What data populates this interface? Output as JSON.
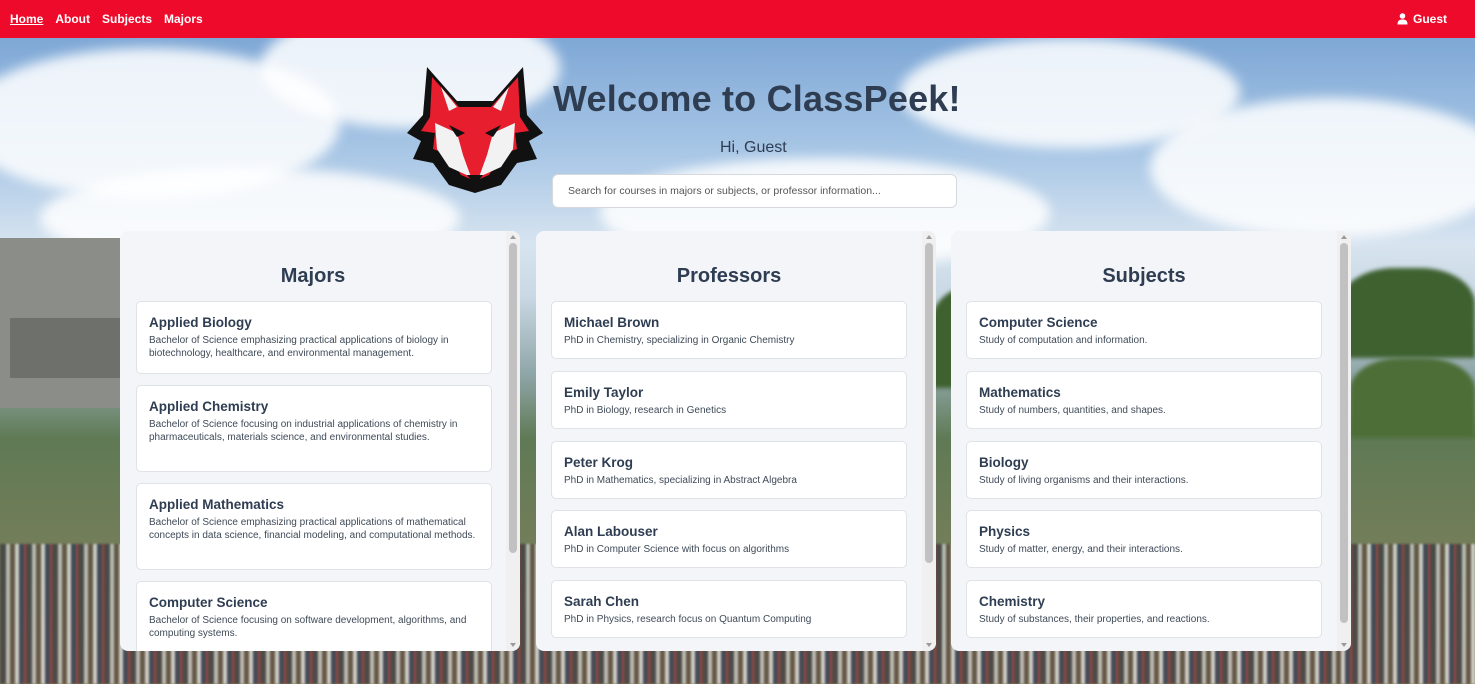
{
  "nav": {
    "links": [
      "Home",
      "About",
      "Subjects",
      "Majors"
    ],
    "user_label": "Guest"
  },
  "header": {
    "title": "Welcome to ClassPeek!",
    "greeting": "Hi, Guest",
    "search_placeholder": "Search for courses in majors or subjects, or professor information..."
  },
  "panels": {
    "majors": {
      "title": "Majors",
      "items": [
        {
          "title": "Applied Biology",
          "desc": "Bachelor of Science emphasizing practical applications of biology in biotechnology, healthcare, and environmental management."
        },
        {
          "title": "Applied Chemistry",
          "desc": "Bachelor of Science focusing on industrial applications of chemistry in pharmaceuticals, materials science, and environmental studies."
        },
        {
          "title": "Applied Mathematics",
          "desc": "Bachelor of Science emphasizing practical applications of mathematical concepts in data science, financial modeling, and computational methods."
        },
        {
          "title": "Computer Science",
          "desc": "Bachelor of Science focusing on software development, algorithms, and computing systems."
        }
      ]
    },
    "professors": {
      "title": "Professors",
      "items": [
        {
          "title": "Michael Brown",
          "desc": "PhD in Chemistry, specializing in Organic Chemistry"
        },
        {
          "title": "Emily Taylor",
          "desc": "PhD in Biology, research in Genetics"
        },
        {
          "title": "Peter Krog",
          "desc": "PhD in Mathematics, specializing in Abstract Algebra"
        },
        {
          "title": "Alan Labouser",
          "desc": "PhD in Computer Science with focus on algorithms"
        },
        {
          "title": "Sarah Chen",
          "desc": "PhD in Physics, research focus on Quantum Computing"
        }
      ]
    },
    "subjects": {
      "title": "Subjects",
      "items": [
        {
          "title": "Computer Science",
          "desc": "Study of computation and information."
        },
        {
          "title": "Mathematics",
          "desc": "Study of numbers, quantities, and shapes."
        },
        {
          "title": "Biology",
          "desc": "Study of living organisms and their interactions."
        },
        {
          "title": "Physics",
          "desc": "Study of matter, energy, and their interactions."
        },
        {
          "title": "Chemistry",
          "desc": "Study of substances, their properties, and reactions."
        }
      ]
    }
  },
  "colors": {
    "brand_red": "#ee0a2b",
    "heading": "#2f3d52",
    "panel_bg": "#f4f5f8"
  }
}
